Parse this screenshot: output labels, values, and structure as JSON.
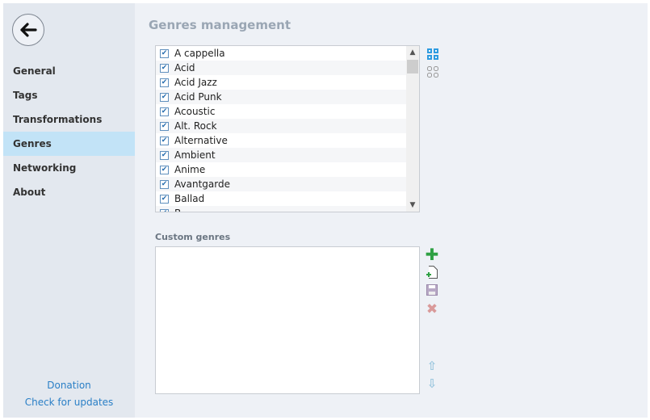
{
  "sidebar": {
    "nav": [
      "General",
      "Tags",
      "Transformations",
      "Genres",
      "Networking",
      "About"
    ],
    "selected": "Genres",
    "donation": "Donation",
    "check_updates": "Check for updates"
  },
  "main": {
    "title": "Genres management",
    "genres": [
      "A cappella",
      "Acid",
      "Acid Jazz",
      "Acid Punk",
      "Acoustic",
      "Alt. Rock",
      "Alternative",
      "Ambient",
      "Anime",
      "Avantgarde",
      "Ballad",
      "B..."
    ],
    "custom_label": "Custom genres",
    "custom_genres": []
  },
  "colors": {
    "accent": "#2a7fc6",
    "selected_bg": "#c2e3f7",
    "add": "#2ea043",
    "delete": "#d99a9a"
  }
}
